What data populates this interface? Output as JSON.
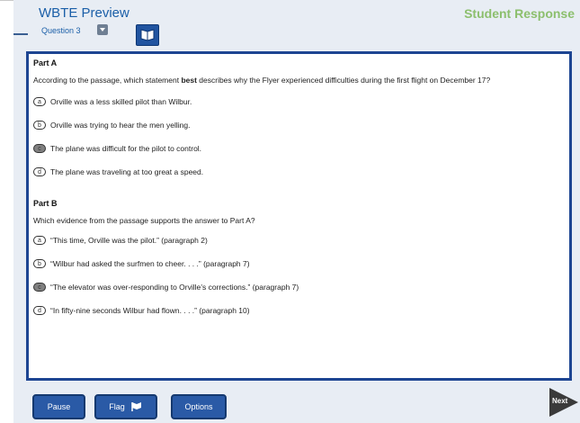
{
  "header": {
    "title": "WBTE Preview",
    "mode": "Student Response",
    "question_label": "Question 3"
  },
  "partA": {
    "heading": "Part A",
    "prompt_pre": "According to the passage, which statement ",
    "prompt_bold": "best",
    "prompt_post": " describes why the Flyer experienced difficulties during the first flight on December 17?",
    "options": [
      {
        "letter": "a",
        "text": "Orville was a less skilled pilot than Wilbur.",
        "selected": false
      },
      {
        "letter": "b",
        "text": "Orville was trying to hear the men yelling.",
        "selected": false
      },
      {
        "letter": "c",
        "text": "The plane was difficult for the pilot to control.",
        "selected": true
      },
      {
        "letter": "d",
        "text": "The plane was traveling at too great a speed.",
        "selected": false
      }
    ]
  },
  "partB": {
    "heading": "Part B",
    "prompt": "Which evidence from the passage supports the answer to Part A?",
    "options": [
      {
        "letter": "a",
        "text": "“This time, Orville was the pilot.” (paragraph 2)",
        "selected": false
      },
      {
        "letter": "b",
        "text": "“Wilbur had asked the surfmen to cheer. . . .” (paragraph 7)",
        "selected": false
      },
      {
        "letter": "c",
        "text": "“The elevator was over-responding to Orville’s corrections.” (paragraph 7)",
        "selected": true
      },
      {
        "letter": "d",
        "text": "“In fifty-nine seconds Wilbur had flown. . . .” (paragraph 10)",
        "selected": false
      }
    ]
  },
  "footer": {
    "pause": "Pause",
    "flag": "Flag",
    "options": "Options",
    "next": "Next"
  },
  "colors": {
    "accent": "#1d4592",
    "button": "#2a5aa6",
    "student_response": "#8cbf6d",
    "title": "#1b5fa8"
  }
}
